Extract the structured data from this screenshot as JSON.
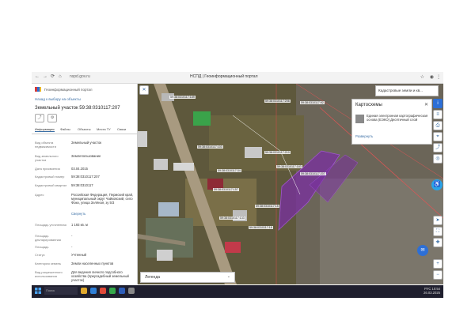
{
  "browser": {
    "url": "nspd.gov.ru",
    "title": "НСПД | Геоинформационный портал"
  },
  "panel": {
    "brand": "Геоинформационный портал",
    "back": "Назад к выбору на объекты",
    "title": "Земельный участок 59:38:0310117:207",
    "tabs": [
      "Информация",
      "Файлы",
      "Объекты",
      "Места ТУ",
      "Связи"
    ],
    "fields": [
      {
        "label": "Вид объекта недвижимости",
        "value": "Земельный участок"
      },
      {
        "label": "Вид земельного участка",
        "value": "Землепользование"
      },
      {
        "label": "Дата присвоения",
        "value": "03.04.2015"
      },
      {
        "label": "Кадастровый номер",
        "value": "59:38:0310117:207"
      },
      {
        "label": "Кадастровый квартал",
        "value": "59:38:0310117"
      },
      {
        "label": "Адрес",
        "value": "Российская Федерация, Пермский край, муниципальный округ Чайковский, село Фоки, улица Зелёная, зу 5/3"
      },
      {
        "label": "",
        "value": "Свернуть"
      },
      {
        "label": "Площадь уточненная",
        "value": "1 193 кв. м"
      },
      {
        "label": "Площадь декларированная",
        "value": "-"
      },
      {
        "label": "Площадь",
        "value": "-"
      },
      {
        "label": "Статус",
        "value": "Учтенный"
      },
      {
        "label": "Категория земель",
        "value": "Земли населенных пунктов"
      },
      {
        "label": "Вид разрешенного использования",
        "value": "Для ведения личного подсобного хозяйства (приусадебный земельный участок)"
      }
    ]
  },
  "map": {
    "layer_select": "Кадастровые земли и кв...",
    "legend_title": "Легенда",
    "labels": [
      "59:38:0310117:207",
      "59:38:0310117:206",
      "59:38:0310117:92",
      "59:38:0310117:189",
      "59:38:0310117:103",
      "59:38:0310117:210",
      "59:38:0310117:183",
      "59:38:0310117:34",
      "59:38:0310117:157",
      "59:38:0310117:15",
      "59:38:0310117:133",
      "59:38:0310117:18"
    ],
    "card": {
      "title": "Картосхемы",
      "desc": "Единая электронная картографическая основа (ЕЭКО) Десятичный слой",
      "more": "Развернуть"
    }
  },
  "taskbar": {
    "search": "Поиск",
    "lang": "РУС",
    "time": "10:54",
    "date": "26.03.2025"
  },
  "colors": {
    "accent": "#3a6ea5",
    "parcel_fill": "#7a2fa0"
  }
}
